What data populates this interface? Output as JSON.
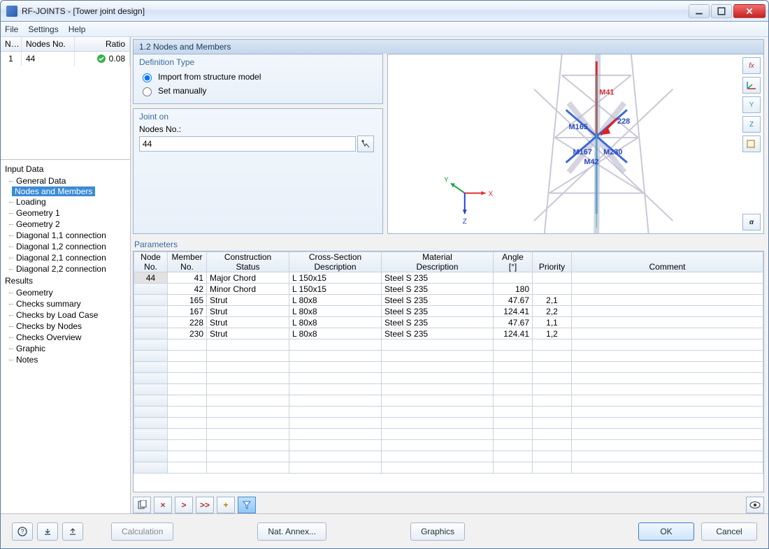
{
  "window": {
    "title": "RF-JOINTS - [Tower joint design]"
  },
  "menu": {
    "file": "File",
    "settings": "Settings",
    "help": "Help"
  },
  "left_table": {
    "headers": {
      "no": "N…",
      "nodes": "Nodes No.",
      "ratio": "Ratio"
    },
    "row": {
      "no": "1",
      "nodes": "44",
      "ratio": "0.08"
    }
  },
  "tree": {
    "input_data": "Input Data",
    "items_input": [
      "General Data",
      "Nodes and Members",
      "Loading",
      "Geometry 1",
      "Geometry 2",
      "Diagonal 1,1 connection",
      "Diagonal 1,2 connection",
      "Diagonal 2,1 connection",
      "Diagonal 2,2 connection"
    ],
    "results": "Results",
    "items_results": [
      "Geometry",
      "Checks summary",
      "Checks by Load Case",
      "Checks by Nodes",
      "Checks Overview",
      "Graphic",
      "Notes"
    ],
    "selected": "Nodes and Members"
  },
  "section": {
    "title": "1.2 Nodes and Members"
  },
  "deftype": {
    "title": "Definition Type",
    "opt1": "Import from structure model",
    "opt2": "Set manually",
    "selected": 0
  },
  "joint_on": {
    "title": "Joint on",
    "label": "Nodes No.:",
    "value": "44"
  },
  "view": {
    "labels": {
      "m41": "M41",
      "m165": "M165",
      "m228": "228",
      "m167": "M167",
      "m230": "M230",
      "m42": "M42",
      "x": "X",
      "y": "Y",
      "z": "Z"
    },
    "buttons": [
      "fx",
      "xyz",
      "y",
      "z",
      "3d",
      "ok"
    ]
  },
  "params": {
    "title": "Parameters",
    "headers": {
      "node": "Node\nNo.",
      "member": "Member\nNo.",
      "cons": "Construction\nStatus",
      "cs": "Cross-Section\nDescription",
      "mat": "Material\nDescription",
      "angle": "Angle\n[°]",
      "priority": "Priority",
      "comment": "Comment"
    },
    "rows": [
      {
        "node": "44",
        "member": "41",
        "cons": "Major Chord",
        "cs": "L 150x15",
        "mat": "Steel S 235",
        "angle": "",
        "priority": "",
        "comment": ""
      },
      {
        "node": "",
        "member": "42",
        "cons": "Minor Chord",
        "cs": "L 150x15",
        "mat": "Steel S 235",
        "angle": "180",
        "priority": "",
        "comment": ""
      },
      {
        "node": "",
        "member": "165",
        "cons": "Strut",
        "cs": "L 80x8",
        "mat": "Steel S 235",
        "angle": "47.67",
        "priority": "2,1",
        "comment": ""
      },
      {
        "node": "",
        "member": "167",
        "cons": "Strut",
        "cs": "L 80x8",
        "mat": "Steel S 235",
        "angle": "124.41",
        "priority": "2,2",
        "comment": ""
      },
      {
        "node": "",
        "member": "228",
        "cons": "Strut",
        "cs": "L 80x8",
        "mat": "Steel S 235",
        "angle": "47.67",
        "priority": "1,1",
        "comment": ""
      },
      {
        "node": "",
        "member": "230",
        "cons": "Strut",
        "cs": "L 80x8",
        "mat": "Steel S 235",
        "angle": "124.41",
        "priority": "1,2",
        "comment": ""
      }
    ]
  },
  "toolbar_icons": {
    "copy": "copy",
    "del": "×",
    "next": ">",
    "fwd": ">>",
    "add": "+",
    "filter": "▼",
    "eye": "👁"
  },
  "footer": {
    "calc": "Calculation",
    "annex": "Nat. Annex...",
    "graphics": "Graphics",
    "ok": "OK",
    "cancel": "Cancel"
  }
}
